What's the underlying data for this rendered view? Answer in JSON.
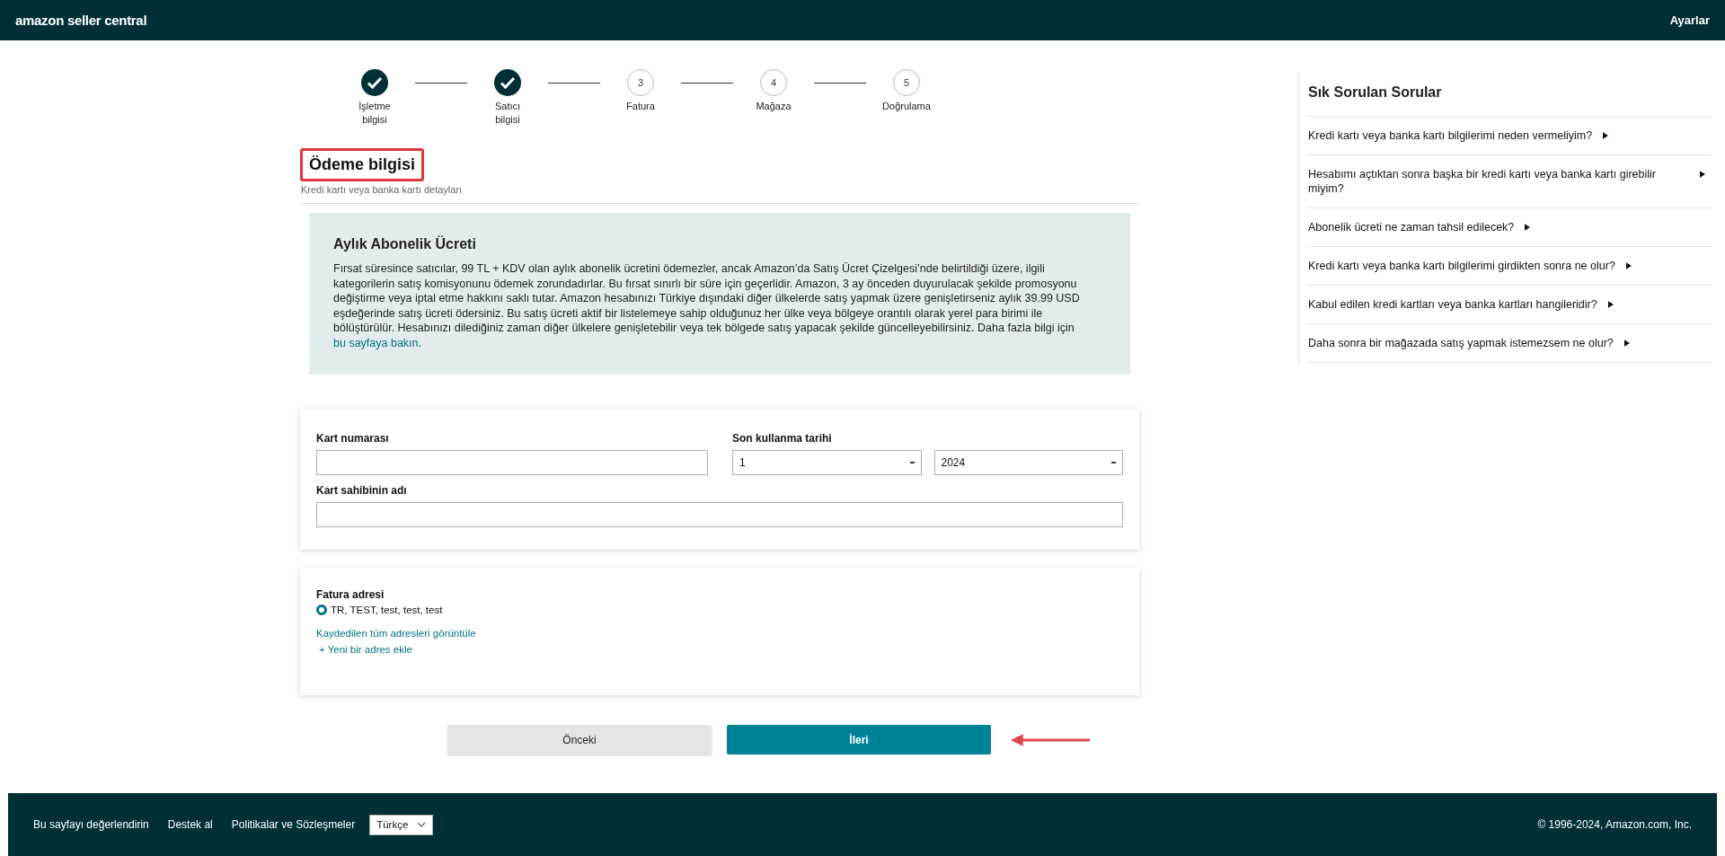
{
  "header": {
    "logo_text": "amazon seller central",
    "settings_link": "Ayarlar"
  },
  "steps": [
    {
      "label": "İşletme bilgisi",
      "done": true
    },
    {
      "label": "Satıcı bilgisi",
      "done": true
    },
    {
      "label": "Fatura",
      "number": "3",
      "done": false
    },
    {
      "label": "Mağaza",
      "number": "4",
      "done": false
    },
    {
      "label": "Doğrulama",
      "number": "5",
      "done": false
    }
  ],
  "page_title": "Ödeme bilgisi",
  "page_subtitle": "Kredi kartı veya banka kartı detayları",
  "info_box": {
    "title": "Aylık Abonelik Ücreti",
    "text": "Fırsat süresince satıcılar, 99 TL + KDV olan aylık abonelik ücretini ödemezler, ancak Amazon’da Satış Ücret Çizelgesi’nde belirtildiği üzere, ilgili kategorilerin satış komisyonunu ödemek zorundadırlar. Bu fırsat sınırlı bir süre için geçerlidir. Amazon, 3 ay önceden duyurulacak şekilde promosyonu değiştirme veya iptal etme hakkını saklı tutar. Amazon hesabınızı Türkiye dışındaki diğer ülkelerde satış yapmak üzere genişletirseniz aylık 39.99 USD eşdeğerinde satış ücreti ödersiniz. Bu satış ücreti aktif bir listelemeye sahip olduğunuz her ülke veya bölgeye orantılı olarak yerel para birimi ile bölüştürülür. Hesabınızı dilediğiniz zaman diğer ülkelere genişletebilir veya tek bölgede satış yapacak şekilde güncelleyebilirsiniz. Daha fazla bilgi için",
    "link": "bu sayfaya bakın",
    "after_link": "."
  },
  "card_form": {
    "card_number_label": "Kart numarası",
    "expiry_label": "Son kullanma tarihi",
    "expiry_month": "1",
    "expiry_year": "2024",
    "holder_label": "Kart sahibinin adı"
  },
  "billing": {
    "label": "Fatura adresi",
    "addresses": [
      {
        "text": "TR, TEST, test, test, test",
        "selected": true
      }
    ],
    "view_all_link": "Kaydedilen tüm adresleri görüntüle",
    "add_link": "+ Yeni bir adres ekle"
  },
  "buttons": {
    "back": "Önceki",
    "next": "İleri"
  },
  "faq": {
    "title": "Sık Sorulan Sorular",
    "items": [
      {
        "question": "Kredi kartı veya banka kartı bilgilerimi neden vermeliyim?"
      },
      {
        "question": "Hesabımı açtıktan sonra başka bir kredi kartı veya banka kartı girebilir miyim?"
      },
      {
        "question": "Abonelik ücreti ne zaman tahsil edilecek?"
      },
      {
        "question": "Kredi kartı veya banka kartı bilgilerimi girdikten sonra ne olur?"
      },
      {
        "question": "Kabul edilen kredi kartları veya banka kartları hangileridir?"
      },
      {
        "question": "Daha sonra bir mağazada satış yapmak istemezsem ne olur?"
      }
    ]
  },
  "footer": {
    "links": [
      "Bu sayfayı değerlendirin",
      "Destek al",
      "Politikalar ve Sözleşmeler"
    ],
    "language": "Türkçe",
    "copyright": "© 1996-2024, Amazon.com, Inc."
  }
}
